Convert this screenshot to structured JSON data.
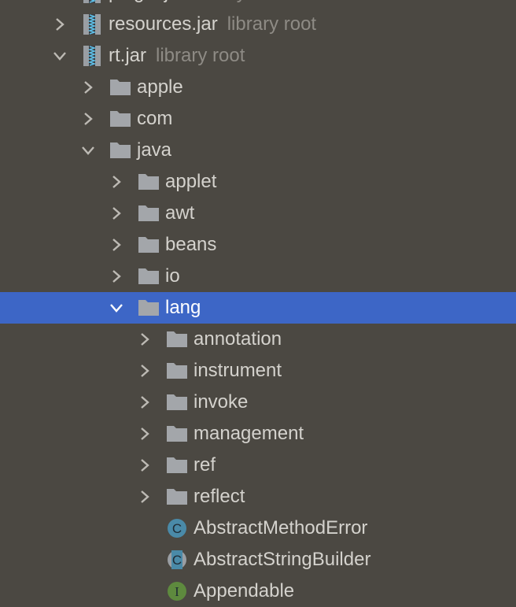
{
  "colors": {
    "background": "#4b4842",
    "selection": "#3d66c6",
    "class_icon": "#4a8aa8",
    "interface_icon": "#5e8a3e"
  },
  "items": [
    {
      "label": "plugin.jar",
      "hint": "library root",
      "icon": "jar-icon",
      "depth": 0,
      "chevron": "right"
    },
    {
      "label": "resources.jar",
      "hint": "library root",
      "icon": "jar-icon",
      "depth": 0,
      "chevron": "right"
    },
    {
      "label": "rt.jar",
      "hint": "library root",
      "icon": "jar-icon",
      "depth": 0,
      "chevron": "down"
    },
    {
      "label": "apple",
      "icon": "folder-icon",
      "depth": 1,
      "chevron": "right"
    },
    {
      "label": "com",
      "icon": "folder-icon",
      "depth": 1,
      "chevron": "right"
    },
    {
      "label": "java",
      "icon": "folder-icon",
      "depth": 1,
      "chevron": "down"
    },
    {
      "label": "applet",
      "icon": "folder-icon",
      "depth": 2,
      "chevron": "right"
    },
    {
      "label": "awt",
      "icon": "folder-icon",
      "depth": 2,
      "chevron": "right"
    },
    {
      "label": "beans",
      "icon": "folder-icon",
      "depth": 2,
      "chevron": "right"
    },
    {
      "label": "io",
      "icon": "folder-icon",
      "depth": 2,
      "chevron": "right"
    },
    {
      "label": "lang",
      "icon": "folder-icon",
      "depth": 2,
      "chevron": "down",
      "selected": true
    },
    {
      "label": "annotation",
      "icon": "folder-icon",
      "depth": 3,
      "chevron": "right"
    },
    {
      "label": "instrument",
      "icon": "folder-icon",
      "depth": 3,
      "chevron": "right"
    },
    {
      "label": "invoke",
      "icon": "folder-icon",
      "depth": 3,
      "chevron": "right"
    },
    {
      "label": "management",
      "icon": "folder-icon",
      "depth": 3,
      "chevron": "right"
    },
    {
      "label": "ref",
      "icon": "folder-icon",
      "depth": 3,
      "chevron": "right"
    },
    {
      "label": "reflect",
      "icon": "folder-icon",
      "depth": 3,
      "chevron": "right"
    },
    {
      "label": "AbstractMethodError",
      "icon": "class-icon",
      "depth": 3,
      "chevron": "none",
      "badge": "C"
    },
    {
      "label": "AbstractStringBuilder",
      "icon": "abstract-class-icon",
      "depth": 3,
      "chevron": "none",
      "badge": "C"
    },
    {
      "label": "Appendable",
      "icon": "interface-icon",
      "depth": 3,
      "chevron": "none",
      "badge": "I"
    }
  ]
}
